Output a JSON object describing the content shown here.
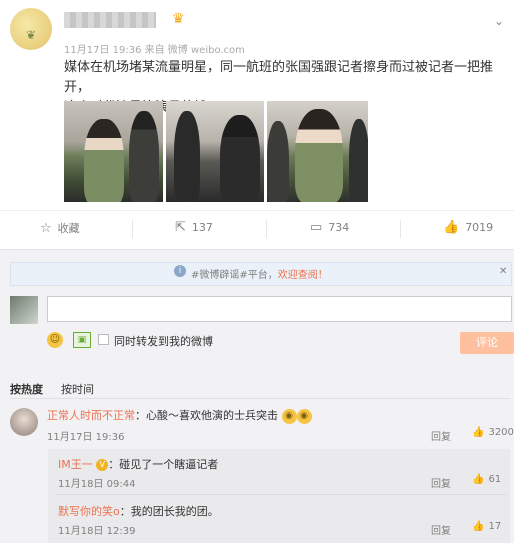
{
  "post": {
    "author": "",
    "meta": "11月17日 19:36 来自 微博 weibo.com",
    "text_line1": "媒体在机场堵某流量明星，同一航班的张国强跟记者擦身而过被记者一把推开，",
    "text_line2": "这个时代流量比演员值钱。"
  },
  "actions": {
    "favorite": "收藏",
    "repost": "137",
    "comment": "734",
    "like": "7019"
  },
  "notice": {
    "prefix": "#微博辟谣#平台，",
    "link": "欢迎查阅！",
    "close": "✕"
  },
  "composer": {
    "input_placeholder": "",
    "repost_label": "同时转发到我的微博",
    "submit_label": "评论"
  },
  "sort": {
    "hot": "按热度",
    "time": "按时间"
  },
  "comments": [
    {
      "name": "正常人时而不正常",
      "text": "：心酸～喜欢他演的士兵突击",
      "time": "11月17日 19:36",
      "reply": "回复",
      "likes": "3200"
    }
  ],
  "replies": [
    {
      "name": "IM王一",
      "text": "：碰见了一个瞎逼记者",
      "time": "11月18日 09:44",
      "reply": "回复",
      "likes": "61"
    },
    {
      "name": "默写你的笑o",
      "text": "：我的团长我的团。",
      "time": "11月18日 12:39",
      "reply": "回复",
      "likes": "17"
    }
  ],
  "icons": {
    "favorite": "star-icon",
    "repost": "share-icon",
    "comment": "comment-icon",
    "like": "thumbs-up-icon"
  }
}
